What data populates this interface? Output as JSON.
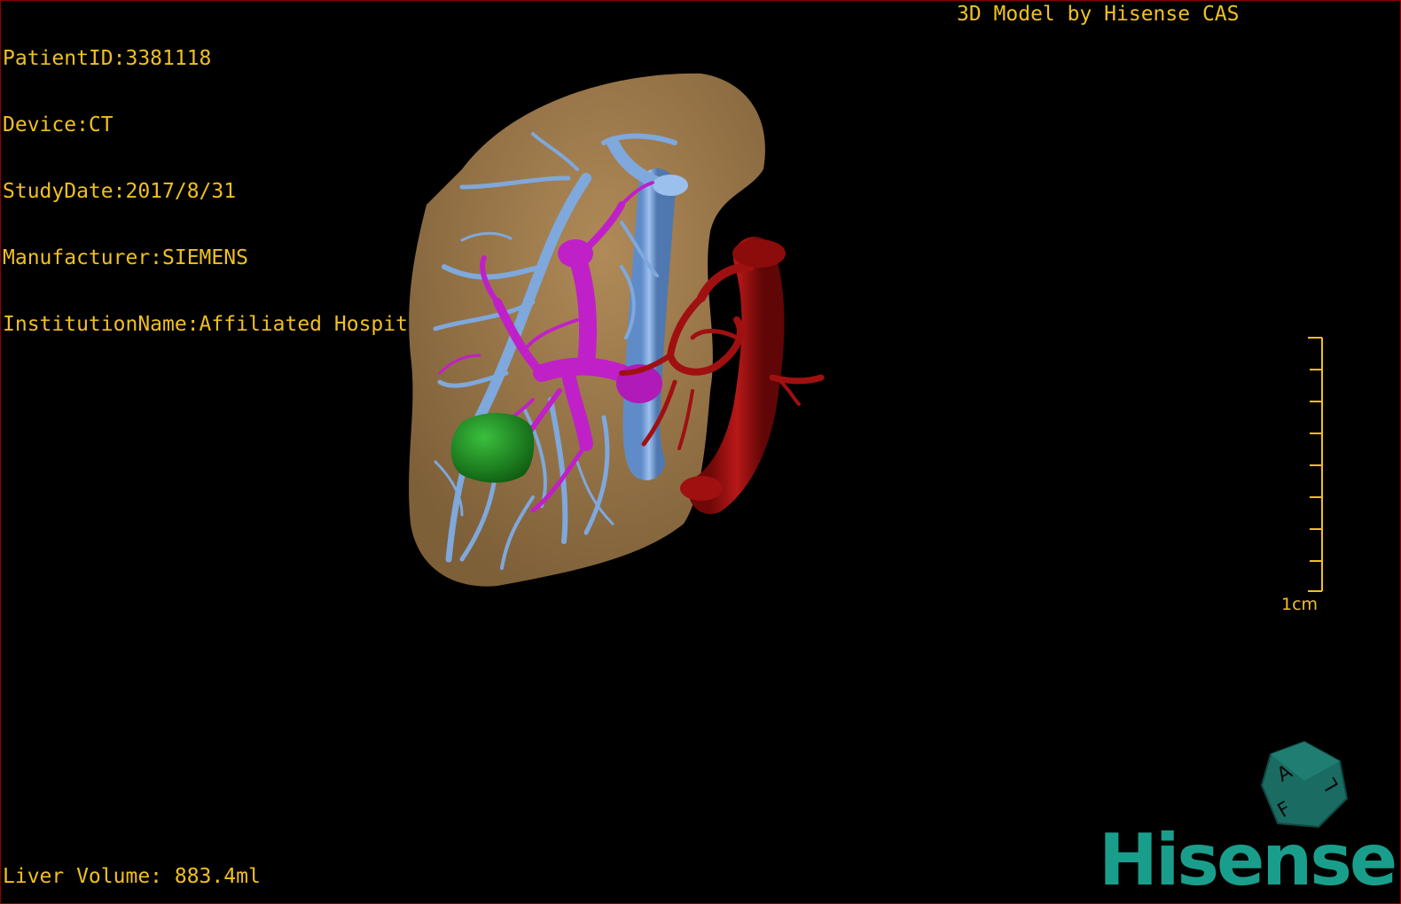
{
  "dicom": {
    "patient_id": "PatientID:3381118",
    "device": "Device:CT",
    "study_date": "StudyDate:2017/8/31",
    "manufacturer": "Manufacturer:SIEMENS",
    "institution": "InstitutionName:Affiliated Hospital Qingdao University-C"
  },
  "brand_title": "3D Model by Hisense CAS",
  "liver_volume": "Liver Volume: 883.4ml",
  "scale_bar": {
    "label": "1cm"
  },
  "orientation_cube": {
    "labels": [
      "A",
      "F",
      "L"
    ]
  },
  "logo": {
    "text": "Hisense"
  },
  "colors": {
    "overlay_text": "#f0c020",
    "liver": "#9c7a4c",
    "hepatic_vein": "#7fa8dc",
    "portal_vein": "#c020c8",
    "artery": "#a01010",
    "lesion": "#1f8f22",
    "brand": "#1a9e8c"
  }
}
